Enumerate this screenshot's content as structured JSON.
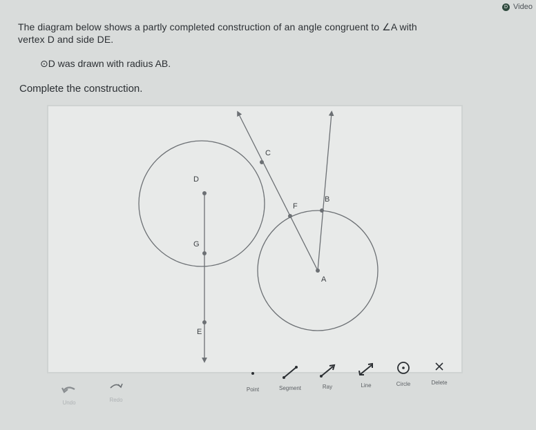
{
  "header": {
    "video_label": "Video",
    "video_icon": "D"
  },
  "prompt": {
    "line1": "The diagram below shows a partly completed construction of an angle congruent to ∠A with",
    "line2": "vertex D and side DE.",
    "sub": "⊙D was drawn with radius AB.",
    "instruction": "Complete the construction."
  },
  "diagram": {
    "labels": {
      "C": "C",
      "D": "D",
      "F": "F",
      "B": "B",
      "G": "G",
      "A": "A",
      "E": "E"
    }
  },
  "toolbar": {
    "undo": "Undo",
    "redo": "Redo",
    "point": "Point",
    "segment": "Segment",
    "ray": "Ray",
    "line": "Line",
    "circle": "Circle",
    "delete": "Delete"
  },
  "colors": {
    "stroke": "#6c7074",
    "canvas": "#e8eae9",
    "background": "#d9dcdb"
  }
}
